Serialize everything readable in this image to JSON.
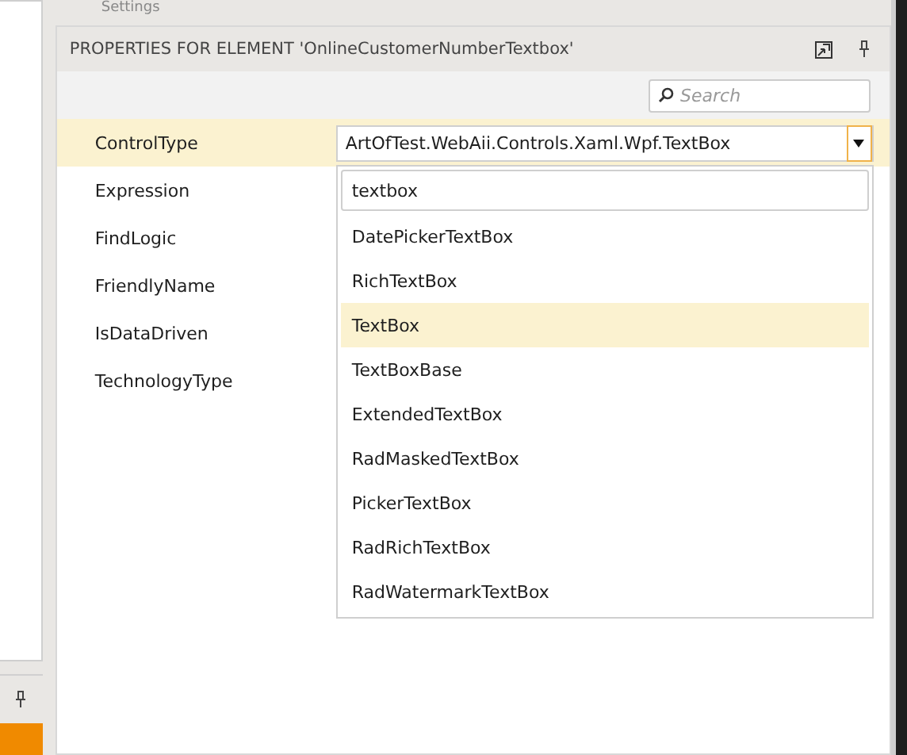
{
  "top_tab": "Settings",
  "panel": {
    "title": "PROPERTIES FOR ELEMENT 'OnlineCustomerNumberTextbox'",
    "search": {
      "placeholder": "Search"
    },
    "properties": [
      {
        "name": "ControlType",
        "selected": true,
        "value": "ArtOfTest.WebAii.Controls.Xaml.Wpf.TextBox"
      },
      {
        "name": "Expression",
        "selected": false
      },
      {
        "name": "FindLogic",
        "selected": false
      },
      {
        "name": "FriendlyName",
        "selected": false
      },
      {
        "name": "IsDataDriven",
        "selected": false
      },
      {
        "name": "TechnologyType",
        "selected": false
      }
    ]
  },
  "dropdown": {
    "filter": "textbox",
    "items": [
      {
        "label": "DatePickerTextBox",
        "selected": false
      },
      {
        "label": "RichTextBox",
        "selected": false
      },
      {
        "label": "TextBox",
        "selected": true
      },
      {
        "label": "TextBoxBase",
        "selected": false
      },
      {
        "label": "ExtendedTextBox",
        "selected": false
      },
      {
        "label": "RadMaskedTextBox",
        "selected": false
      },
      {
        "label": "PickerTextBox",
        "selected": false
      },
      {
        "label": "RadRichTextBox",
        "selected": false
      },
      {
        "label": "RadWatermarkTextBox",
        "selected": false
      }
    ]
  }
}
